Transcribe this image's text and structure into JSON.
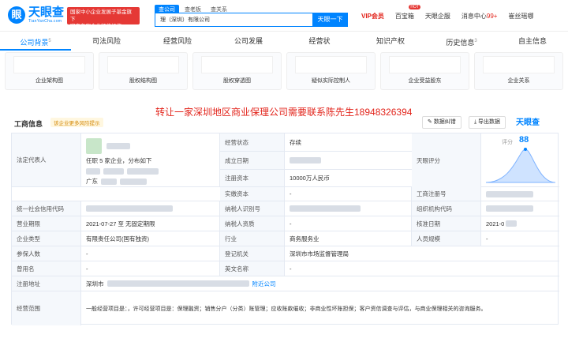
{
  "header": {
    "logo_cn": "天眼查",
    "logo_en": "TianYanCha.com",
    "banner_line1": "国家中小企业发展子基金旗下",
    "banner_line2": "官方备案企业征信机构",
    "search_tabs": [
      "查公司",
      "查老板",
      "查关系"
    ],
    "search_value": "理（深圳）有限公司",
    "search_button": "天眼一下",
    "vip": "VIP会员",
    "nav_baiyan": "百宝箱",
    "nav_hot": "HOT",
    "nav_qiye": "天眼企服",
    "nav_msg": "消息中心",
    "nav_msg_count": "99+",
    "nav_user": "崔丝瑶哪"
  },
  "tabs": [
    {
      "label": "公司背景",
      "count": "5"
    },
    {
      "label": "司法风险",
      "count": ""
    },
    {
      "label": "经营风险",
      "count": ""
    },
    {
      "label": "公司发展",
      "count": ""
    },
    {
      "label": "经营状",
      "count": ""
    },
    {
      "label": "知识产权",
      "count": ""
    },
    {
      "label": "历史信息",
      "count": "3"
    },
    {
      "label": "自主信息",
      "count": ""
    }
  ],
  "cards": [
    "企业架构图",
    "股权结构图",
    "股权穿透图",
    "疑似实际控制人",
    "企业受益股东",
    "企业关系"
  ],
  "section": {
    "title": "工商信息",
    "warn": "该企业更多风险提示",
    "ad": "转让一家深圳地区商业保理公司需要联系陈先生18948326394",
    "btn_error": "数据纠错",
    "btn_export": "导出数据",
    "brand": "天眼查"
  },
  "info": {
    "legal_label": "法定代表人",
    "legal_tenure": "任职 5 家企业，分布如下",
    "legal_region": "广东",
    "status_label": "经营状态",
    "status_value": "存续",
    "founded_label": "成立日期",
    "capital_label": "注册资本",
    "capital_value": "10000万人民币",
    "paid_label": "实缴资本",
    "paid_value": "-",
    "score_label": "天眼评分",
    "score_text": "评分",
    "score_value": "88",
    "reg_no_label": "工商注册号",
    "credit_label": "统一社会信用代码",
    "taxpayer_label": "纳税人识别号",
    "org_label": "组织机构代码",
    "term_label": "营业期限",
    "term_value": "2021-07-27  至  无固定期限",
    "tax_quality_label": "纳税人资质",
    "tax_quality_value": "-",
    "approve_label": "核准日期",
    "approve_value": "2021-0",
    "type_label": "企业类型",
    "type_value": "有限责任公司(国有独资)",
    "industry_label": "行业",
    "industry_value": "商务服务业",
    "staff_label": "人员规模",
    "staff_value": "-",
    "insured_label": "参保人数",
    "insured_value": "-",
    "authority_label": "登记机关",
    "authority_value": "深圳市市场监督管理局",
    "former_label": "曾用名",
    "former_value": "-",
    "english_label": "英文名称",
    "english_value": "-",
    "address_label": "注册地址",
    "address_value": "深圳市",
    "address_link": "附近公司",
    "scope_label": "经营范围",
    "scope_value": "一般经营项目是：，许可经营项目是：保理融资；销售分户（分类）账管理；应收账款催收；非商业性坏账担保；客户资信调查与评估，与商业保理相关的咨询服务。"
  }
}
